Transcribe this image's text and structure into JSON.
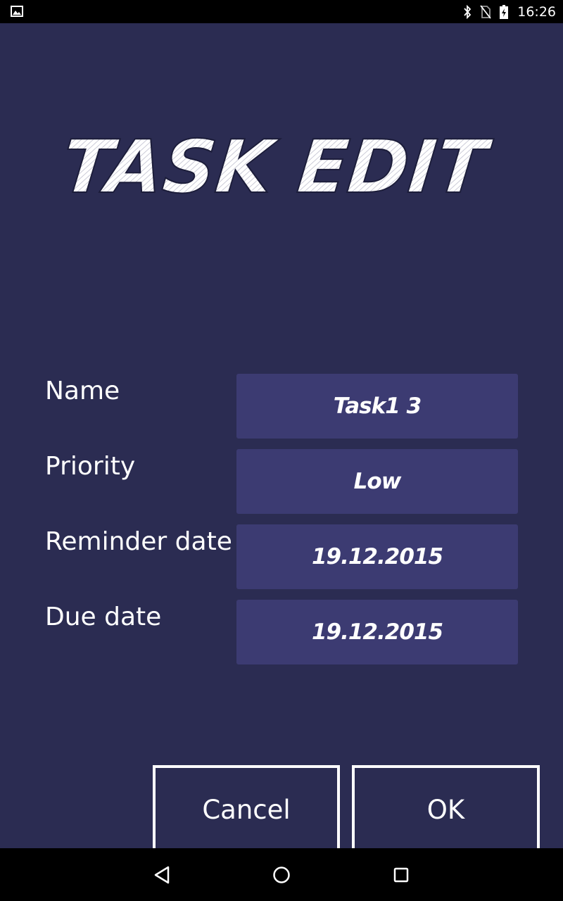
{
  "status_bar": {
    "time": "16:26",
    "icons": [
      "image-notification-icon",
      "bluetooth-icon",
      "no-sim-icon",
      "battery-charging-icon"
    ]
  },
  "header": {
    "title": "TASK EDIT"
  },
  "form": {
    "name": {
      "label": "Name",
      "value": "Task1 3"
    },
    "priority": {
      "label": "Priority",
      "value": "Low"
    },
    "reminder_date": {
      "label": "Reminder date",
      "value": "19.12.2015"
    },
    "due_date": {
      "label": "Due date",
      "value": "19.12.2015"
    }
  },
  "actions": {
    "cancel_label": "Cancel",
    "ok_label": "OK"
  },
  "nav_bar": {
    "icons": [
      "back-icon",
      "home-icon",
      "recents-icon"
    ]
  },
  "colors": {
    "background": "#2b2c52",
    "field_background": "#3c3b72",
    "text": "#ffffff",
    "system_bar": "#000000"
  }
}
